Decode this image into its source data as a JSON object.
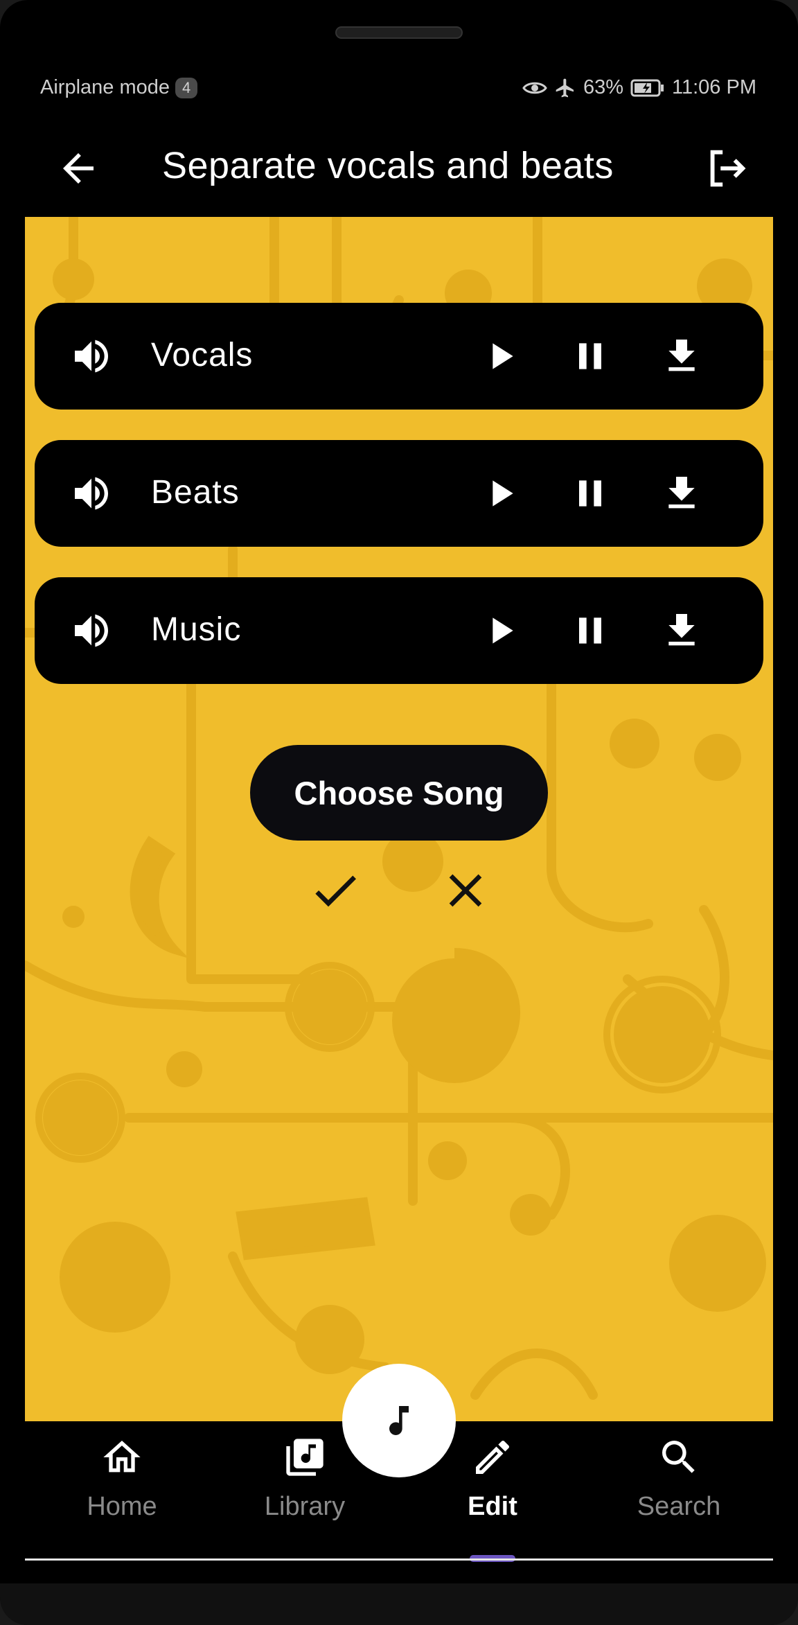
{
  "status_bar": {
    "left_text": "Airplane mode",
    "badge": "4",
    "battery_percent": "63%",
    "time": "11:06 PM"
  },
  "app_bar": {
    "title": "Separate vocals and beats",
    "back_icon": "arrow-left-icon",
    "logout_icon": "logout-icon"
  },
  "tracks": [
    {
      "label": "Vocals"
    },
    {
      "label": "Beats"
    },
    {
      "label": "Music"
    }
  ],
  "actions": {
    "choose_song_label": "Choose Song"
  },
  "bottom_nav": {
    "items": [
      {
        "label": "Home",
        "icon": "home-icon"
      },
      {
        "label": "Library",
        "icon": "library-music-icon"
      },
      {
        "label": "Edit",
        "icon": "pencil-icon",
        "active": true
      },
      {
        "label": "Search",
        "icon": "search-icon"
      }
    ],
    "fab_icon": "music-note-icon"
  },
  "colors": {
    "content_background": "#f0bd2c",
    "active_indicator": "#6b55c0",
    "track_card": "#000000"
  }
}
